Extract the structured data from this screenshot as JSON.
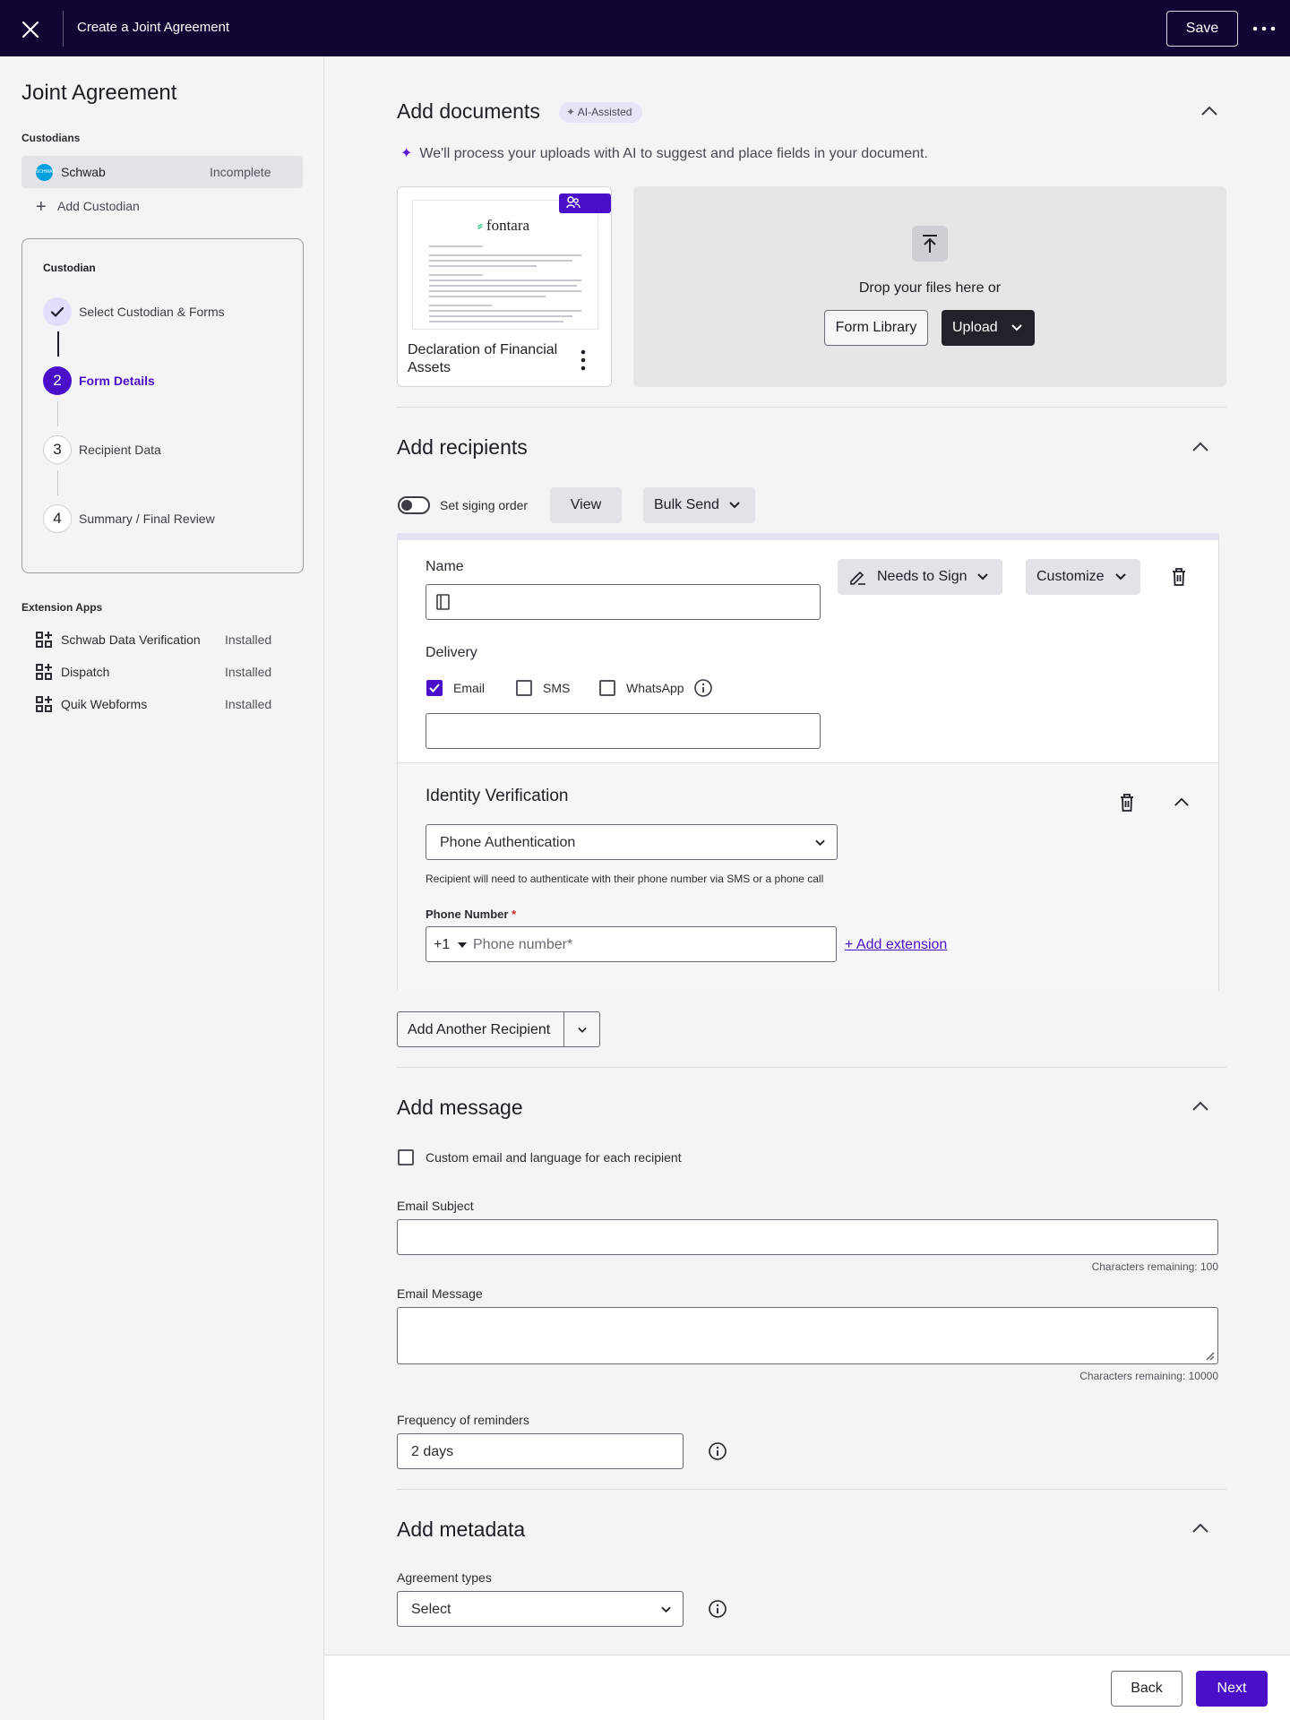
{
  "topbar": {
    "title": "Create a Joint Agreement",
    "save_label": "Save"
  },
  "sidebar": {
    "title": "Joint Agreement",
    "custodians_caption": "Custodians",
    "custodian": {
      "logo_text": "SCHWAB",
      "name": "Schwab",
      "status": "Incomplete"
    },
    "add_custodian": "Add Custodian",
    "stepper": {
      "caption": "Custodian",
      "steps": [
        {
          "number": "1",
          "label": "Select Custodian & Forms",
          "state": "done"
        },
        {
          "number": "2",
          "label": "Form Details",
          "state": "active"
        },
        {
          "number": "3",
          "label": "Recipient Data",
          "state": "todo"
        },
        {
          "number": "4",
          "label": "Summary / Final Review",
          "state": "todo"
        }
      ]
    },
    "extensions_caption": "Extension Apps",
    "extensions": [
      {
        "name": "Schwab Data Verification",
        "status": "Installed"
      },
      {
        "name": "Dispatch",
        "status": "Installed"
      },
      {
        "name": "Quik Webforms",
        "status": "Installed"
      }
    ]
  },
  "documents": {
    "title": "Add documents",
    "badge": "AI-Assisted",
    "note": "We'll process your uploads with AI to suggest and place fields in your document.",
    "doc": {
      "name": "Declaration of Financial Assets",
      "shared_label": "Shared",
      "brand": "fontara"
    },
    "drop_text": "Drop your files here or",
    "form_library_label": "Form Library",
    "upload_label": "Upload"
  },
  "recipients": {
    "title": "Add recipients",
    "signing_order_label": "Set siging order",
    "view_label": "View",
    "bulk_send_label": "Bulk Send",
    "name_label": "Name",
    "name_value": "",
    "role_label": "Needs to Sign",
    "customize_label": "Customize",
    "delivery_label": "Delivery",
    "delivery_options": [
      {
        "label": "Email",
        "checked": true
      },
      {
        "label": "SMS",
        "checked": false
      },
      {
        "label": "WhatsApp",
        "checked": false
      }
    ],
    "email_value": "",
    "identity": {
      "title": "Identity Verification",
      "method": "Phone Authentication",
      "hint": "Recipient will need to authenticate with their phone number via SMS or a phone call",
      "phone_label": "Phone Number",
      "required_mark": "*",
      "country_code": "+1",
      "phone_placeholder": "Phone number*",
      "add_extension": "+ Add extension"
    },
    "add_another_label": "Add Another Recipient"
  },
  "message": {
    "title": "Add message",
    "custom_label": "Custom email and language for each recipient",
    "subject_label": "Email Subject",
    "subject_value": "",
    "subject_remaining": "Characters remaining: 100",
    "message_label": "Email Message",
    "message_value": "",
    "message_remaining": "Characters remaining: 10000",
    "frequency_label": "Frequency of reminders",
    "frequency_value": "2 days"
  },
  "metadata": {
    "title": "Add metadata",
    "agreement_types_label": "Agreement types",
    "agreement_types_value": "Select"
  },
  "footer": {
    "back_label": "Back",
    "next_label": "Next"
  },
  "colors": {
    "topbar": "#130533",
    "accent": "#4a10c9",
    "dark_button": "#23212a"
  }
}
